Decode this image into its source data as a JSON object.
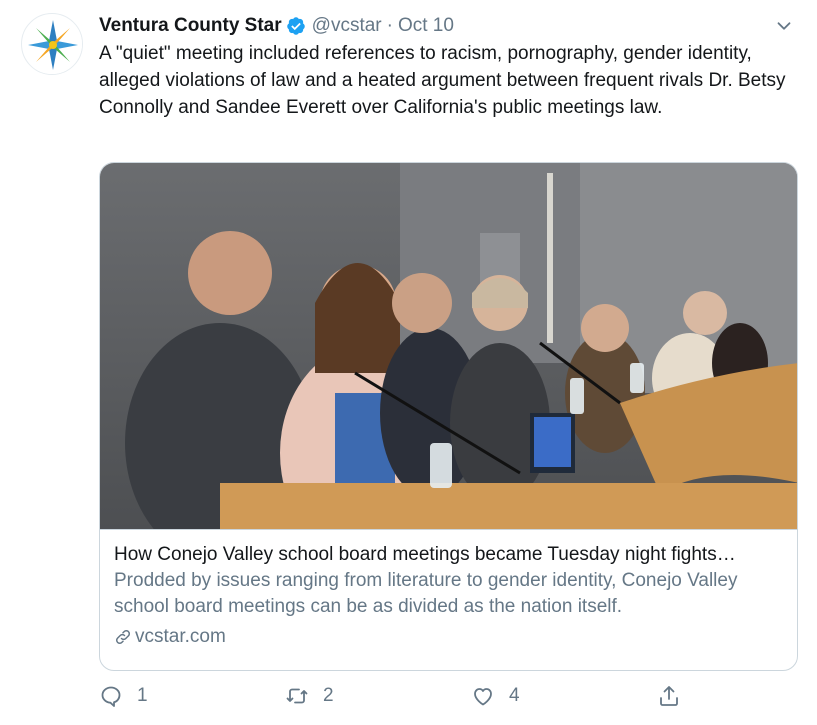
{
  "author": {
    "name": "Ventura County Star",
    "handle": "@vcstar",
    "separator": "·",
    "date": "Oct 10"
  },
  "tweet": {
    "text": "A \"quiet\" meeting included references to racism, pornography, gender identity, alleged violations of law and a heated argument between frequent rivals Dr. Betsy Connolly and Sandee Everett over California's public meetings law."
  },
  "card": {
    "title": "How Conejo Valley school board meetings became Tuesday night fights…",
    "description": "Prodded by issues ranging from literature to gender identity, Conejo Valley school board meetings can be as divided as the nation itself.",
    "domain": "vcstar.com"
  },
  "actions": {
    "reply_count": "1",
    "retweet_count": "2",
    "like_count": "4"
  },
  "colors": {
    "text": "#14171a",
    "secondary": "#657786",
    "verified": "#1da1f2",
    "border": "#ccd6dd"
  },
  "icons": [
    "verified-badge-icon",
    "chevron-down-icon",
    "link-icon",
    "reply-icon",
    "retweet-icon",
    "like-icon",
    "share-icon"
  ]
}
